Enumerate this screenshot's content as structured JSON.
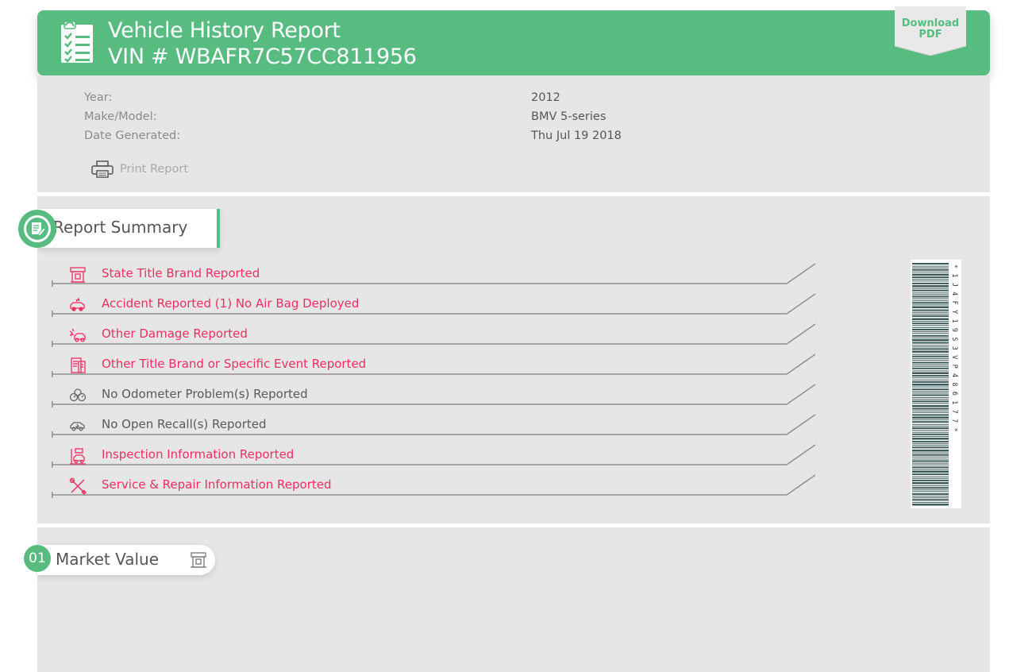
{
  "header": {
    "icon": "checklist-icon",
    "title": "Vehicle History Report",
    "vin": "VIN # WBAFR7C57CC811956",
    "download_label_1": "Download",
    "download_label_2": "PDF"
  },
  "vehicle": {
    "rows": [
      {
        "label": "Year:",
        "value": "2012"
      },
      {
        "label": "Make/Model:",
        "value": "BMV 5-series"
      },
      {
        "label": "Date Generated:",
        "value": "Thu Jul 19 2018"
      }
    ],
    "print_label": "Print Report",
    "print_icon": "printer-icon"
  },
  "summary": {
    "title": "Report Summary",
    "badge_icon": "report-edit-icon",
    "items": [
      {
        "label": "State Title Brand Reported",
        "status": "alert",
        "icon": "title-brand-icon"
      },
      {
        "label": "Accident Reported (1) No Air Bag Deployed",
        "status": "alert",
        "icon": "car-crash-icon"
      },
      {
        "label": "Other Damage Reported",
        "status": "alert",
        "icon": "damage-icon"
      },
      {
        "label": "Other Title Brand or Specific Event Reported",
        "status": "alert",
        "icon": "document-icon"
      },
      {
        "label": "No Odometer Problem(s) Reported",
        "status": "ok",
        "icon": "odometer-icon"
      },
      {
        "label": "No Open Recall(s) Reported",
        "status": "ok",
        "icon": "recall-icon"
      },
      {
        "label": "Inspection Information Reported",
        "status": "alert",
        "icon": "inspection-icon"
      },
      {
        "label": "Service & Repair Information Reported",
        "status": "alert",
        "icon": "tools-icon"
      }
    ],
    "barcode_text": "*1J4FY19S3VP486177*"
  },
  "market": {
    "number": "01",
    "title": "Market Value",
    "icon": "dealership-icon"
  },
  "colors": {
    "brand_green": "#58bb80",
    "alert_red": "#ee2d61",
    "ok_gray": "#595959",
    "panel_bg": "#e6e6e6"
  }
}
